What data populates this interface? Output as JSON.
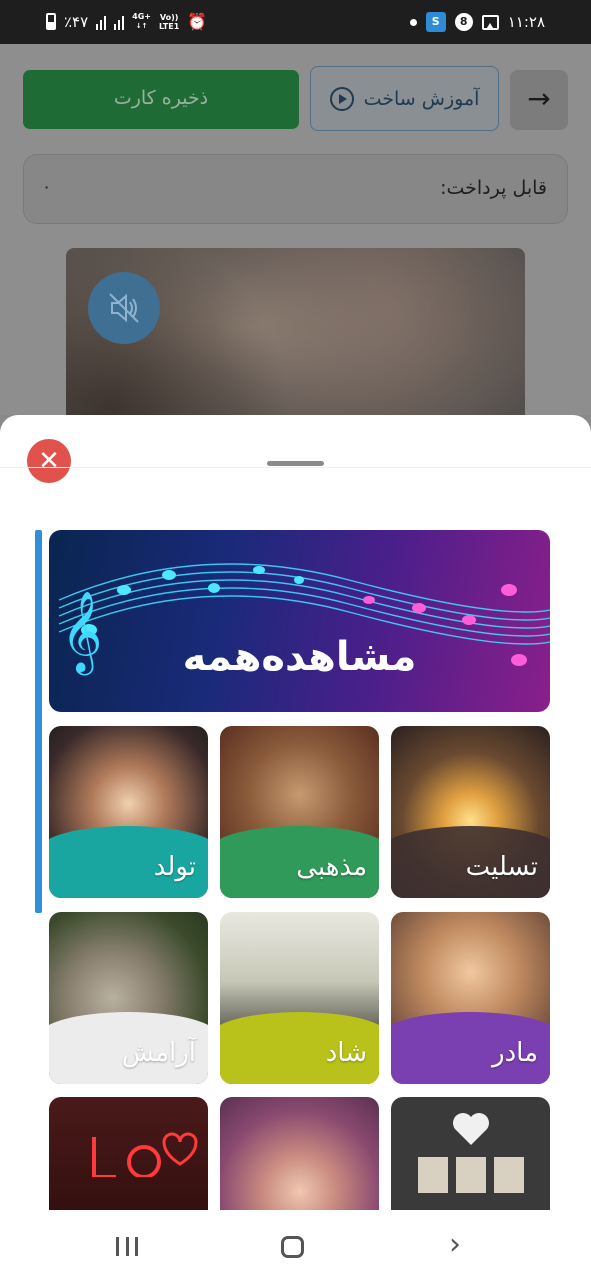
{
  "status_bar": {
    "battery": "٪۴۷",
    "network": "4G+",
    "network_sub": "LTE1",
    "volte": "Vo))",
    "app_badge": "8",
    "time": "۱۱:۲۸"
  },
  "background": {
    "save_button": "ذخیره کارت",
    "tutorial_button": "آموزش ساخت",
    "payable_label": "قابل پرداخت:",
    "payable_value": "۰"
  },
  "sheet": {
    "hero_label": "مشاهده‌همه",
    "categories": [
      {
        "label": "تسلیت",
        "wave_color": "#3d3030"
      },
      {
        "label": "مذهبی",
        "wave_color": "#2f9a5a"
      },
      {
        "label": "تولد",
        "wave_color": "#1aa6a0"
      },
      {
        "label": "مادر",
        "wave_color": "#7a3fb0"
      },
      {
        "label": "شاد",
        "wave_color": "#b8c21a"
      },
      {
        "label": "آرامش",
        "wave_color": "#ececec"
      }
    ]
  },
  "colors": {
    "save": "#1f6b35",
    "close": "#e0524b",
    "accent": "#2f8fd8"
  }
}
